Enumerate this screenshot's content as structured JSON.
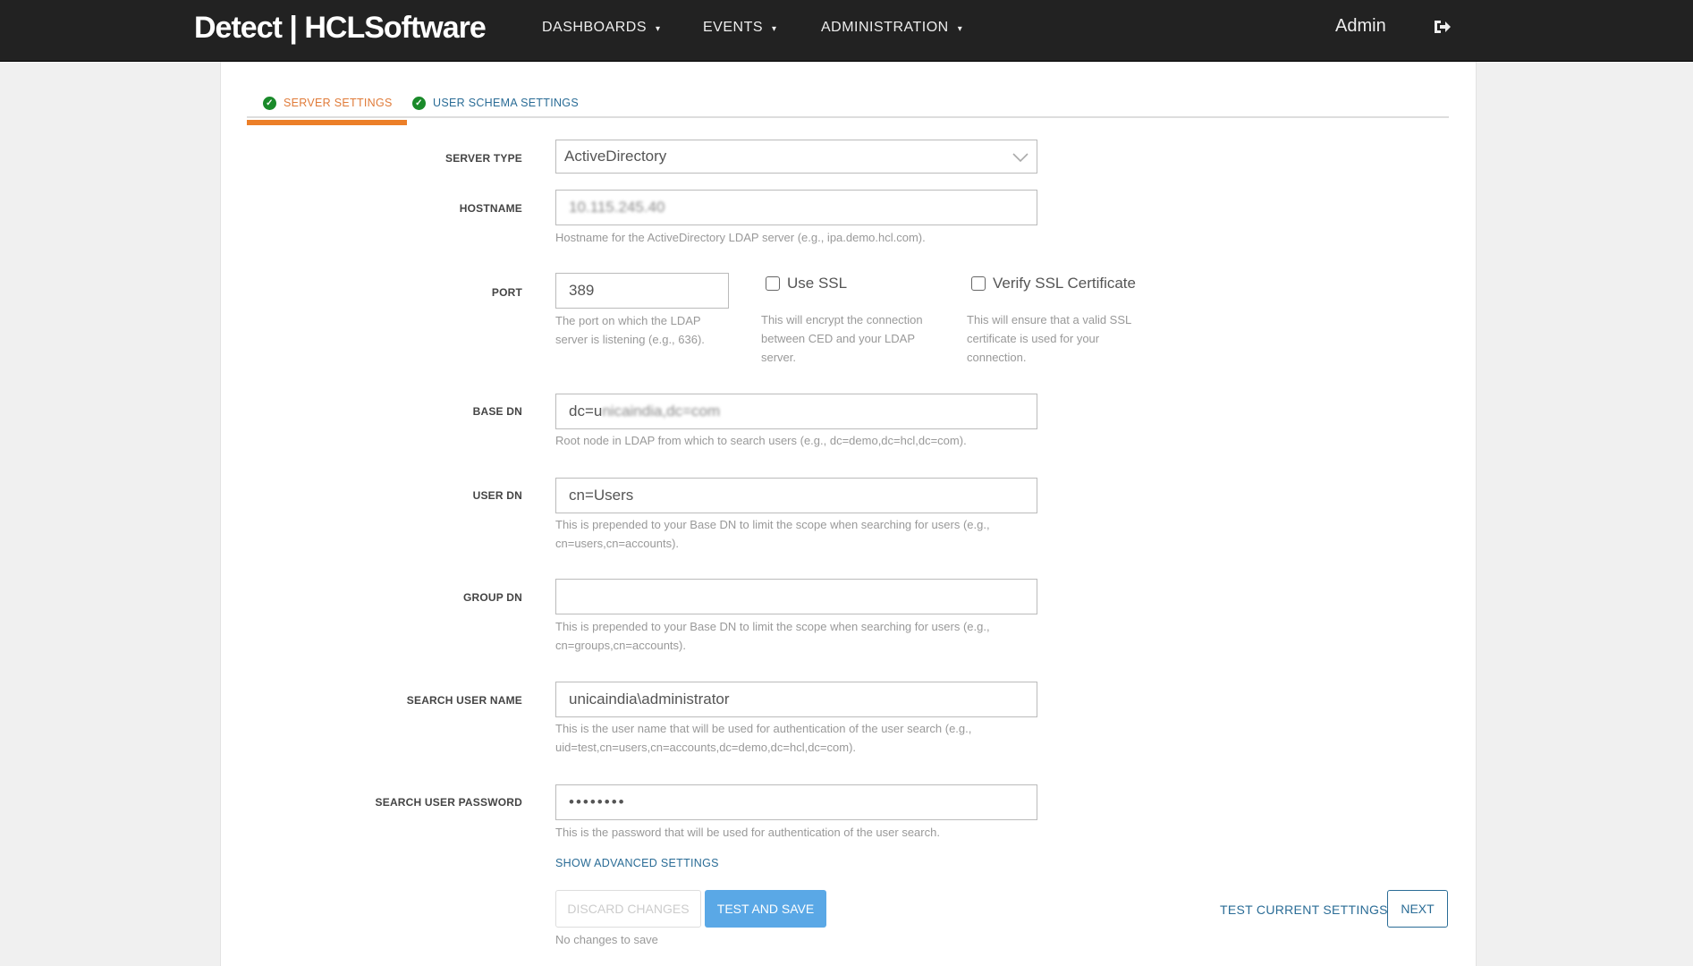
{
  "nav": {
    "logo": "Detect | HCLSoftware",
    "items": [
      "DASHBOARDS",
      "EVENTS",
      "ADMINISTRATION"
    ],
    "caret": "▾",
    "user": "Admin",
    "logout_icon": "sign-out-icon"
  },
  "tabs": [
    {
      "label": "SERVER SETTINGS",
      "active": true
    },
    {
      "label": "USER SCHEMA SETTINGS",
      "active": false
    }
  ],
  "form": {
    "server_type": {
      "label": "SERVER TYPE",
      "value": "ActiveDirectory"
    },
    "hostname": {
      "label": "HOSTNAME",
      "value": "10.115.245.40",
      "help": "Hostname for the ActiveDirectory LDAP server (e.g., ipa.demo.hcl.com)."
    },
    "port": {
      "label": "PORT",
      "value": "389",
      "help": "The port on which the LDAP server is listening (e.g., 636)."
    },
    "use_ssl": {
      "label": "Use SSL",
      "checked": false,
      "help": "This will encrypt the connection between CED and your LDAP server."
    },
    "verify_ssl": {
      "label": "Verify SSL Certificate",
      "checked": false,
      "help": "This will ensure that a valid SSL certificate is used for your connection."
    },
    "base_dn": {
      "label": "BASE DN",
      "value_prefix": "dc=u",
      "value_blurred": "nicaindia,dc=com",
      "help": "Root node in LDAP from which to search users (e.g., dc=demo,dc=hcl,dc=com)."
    },
    "user_dn": {
      "label": "USER DN",
      "value": "cn=Users",
      "help": "This is prepended to your Base DN to limit the scope when searching for users (e.g., cn=users,cn=accounts)."
    },
    "group_dn": {
      "label": "GROUP DN",
      "value": "",
      "help": "This is prepended to your Base DN to limit the scope when searching for users (e.g., cn=groups,cn=accounts)."
    },
    "search_user": {
      "label": "SEARCH USER NAME",
      "value": "unicaindia\\administrator",
      "help": "This is the user name that will be used for authentication of the user search (e.g., uid=test,cn=users,cn=accounts,dc=demo,dc=hcl,dc=com)."
    },
    "search_password": {
      "label": "SEARCH USER PASSWORD",
      "value": "••••••••",
      "help": "This is the password that will be used for authentication of the user search."
    }
  },
  "actions": {
    "advanced": "SHOW ADVANCED SETTINGS",
    "discard": "DISCARD CHANGES",
    "test_save": "TEST AND SAVE",
    "status": "No changes to save",
    "test_current": "TEST CURRENT SETTINGS",
    "next": "NEXT"
  },
  "colors": {
    "accent": "#ec7f28",
    "link": "#2a6c96",
    "primary": "#5aa8e6",
    "check": "#1a8a2a"
  }
}
